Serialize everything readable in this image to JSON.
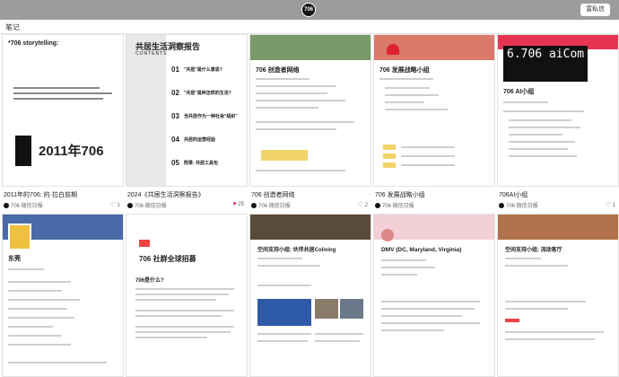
{
  "titlebar": {
    "logo": "706",
    "button": "富私信"
  },
  "header": {
    "title": "笔记"
  },
  "row1": [
    {
      "id": "c1",
      "thumb_title": "*706 storytelling:",
      "thumb_big": "2011年706",
      "caption": "2011年的706: 的·拉白前期",
      "author": "706 微信日报",
      "likes": "1",
      "liked": false
    },
    {
      "id": "c2",
      "thumb_title": "共居生活洞察报告",
      "thumb_sub": "CONTENTS",
      "toc": [
        {
          "n": "01",
          "t": "\"共居\"是什么意思?"
        },
        {
          "n": "02",
          "t": "\"共居\"是种怎样的生活?"
        },
        {
          "n": "03",
          "t": "当共居作为一种社会\"组织\""
        },
        {
          "n": "04",
          "t": "共居的运营经验"
        },
        {
          "n": "05",
          "t": "附录: 共居工具包"
        }
      ],
      "caption": "2024《共居生活洞察报告》",
      "author": "706 微信日报",
      "likes": "25",
      "liked": true
    },
    {
      "id": "c3",
      "thumb_title": "706 创造者网络",
      "caption": "706 创造者网络",
      "author": "706 微信日报",
      "likes": "2",
      "liked": false
    },
    {
      "id": "c4",
      "thumb_title": "706 发展战略小组",
      "caption": "706 发展战略小组",
      "author": "706 微信日报",
      "likes": "",
      "liked": false
    },
    {
      "id": "c5",
      "thumb_title": "706 AI小组",
      "thumb_logo": "6.706 aiCom",
      "caption": "706AI小组",
      "author": "706 微信日报",
      "likes": "1",
      "liked": false
    }
  ],
  "row2": [
    {
      "id": "c6",
      "thumb_title": "东莞"
    },
    {
      "id": "c7",
      "thumb_title": "706 社群全球招募",
      "thumb_sub": "706是什么?"
    },
    {
      "id": "c8",
      "thumb_title": "空间支持小组: 伙伴共居Coliving"
    },
    {
      "id": "c9",
      "thumb_title": "DMV (DC, Maryland, Virginia)"
    },
    {
      "id": "c10",
      "thumb_title": "空间支持小组: 流动客厅"
    }
  ]
}
